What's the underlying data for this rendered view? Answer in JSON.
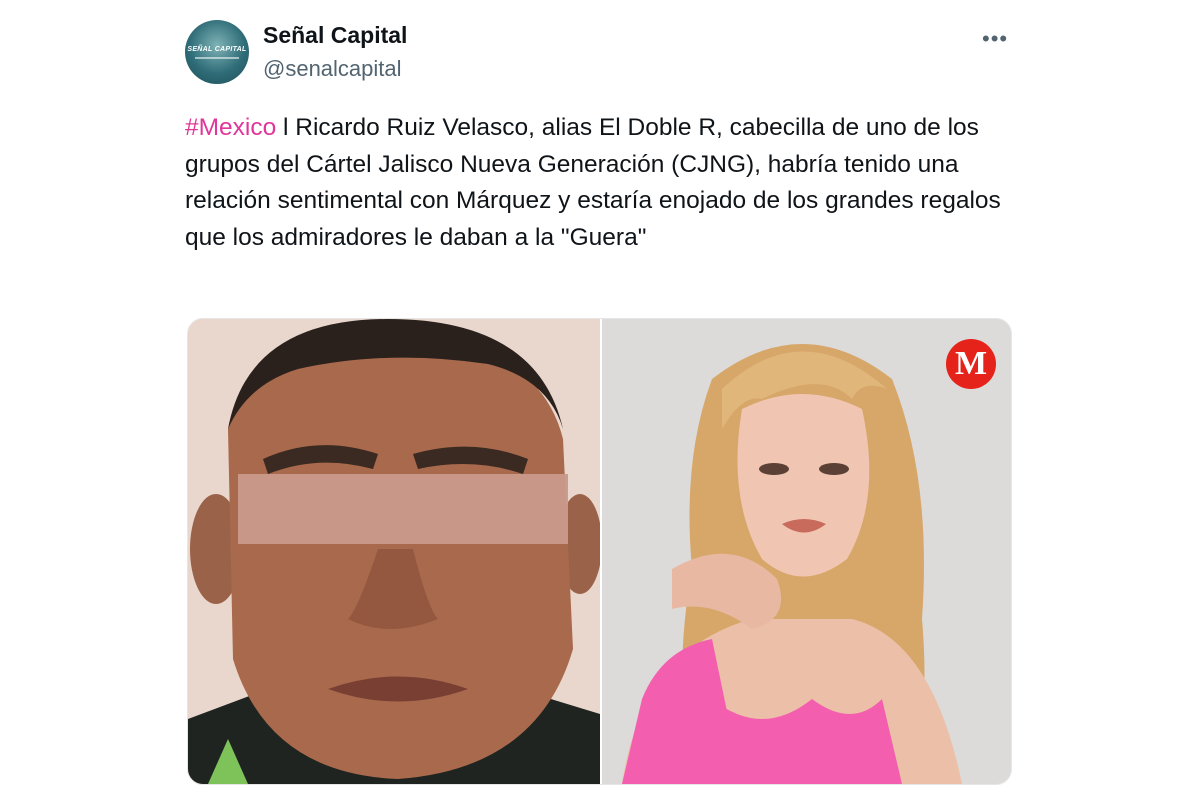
{
  "author": {
    "display_name": "Señal Capital",
    "handle": "@senalcapital",
    "avatar_text": "SEÑAL CAPITAL"
  },
  "more_label": "•••",
  "tweet": {
    "hashtag": "#Mexico",
    "body": " l Ricardo Ruiz Velasco, alias El Doble R, cabecilla de uno de los grupos del Cártel Jalisco Nueva Generación (CJNG), habría tenido una relación sentimental con Márquez y estaría enojado de los grandes regalos que los admiradores le daban a la \"Guera\""
  },
  "media": {
    "badge_letter": "M",
    "colors": {
      "badge": "#e5231b",
      "top_pink": "#f35fae",
      "hashtag": "#e0359a"
    }
  }
}
